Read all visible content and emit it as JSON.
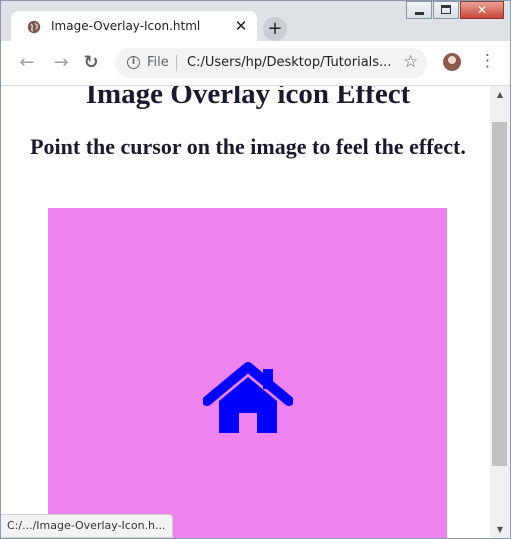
{
  "browser": {
    "tab_title": "Image-Overlay-Icon.html",
    "tab_close": "✕",
    "new_tab": "+",
    "window_close": "✕",
    "nav": {
      "back": "←",
      "forward": "→",
      "reload": "↻"
    },
    "omnibox": {
      "info": "i",
      "scheme": "File",
      "url": "C:/Users/hp/Desktop/Tutorials..."
    },
    "star": "☆",
    "menu": "⋮",
    "status_url": "C:/.../Image-Overlay-Icon.h..."
  },
  "page": {
    "heading": "Image Overlay icon Effect",
    "subheading": "Point the cursor on the image to feel the effect."
  },
  "scrollbar": {
    "up": "▲",
    "down": "▼"
  },
  "colors": {
    "overlay_background": "#ee82ee",
    "icon_color": "#0000ff"
  }
}
